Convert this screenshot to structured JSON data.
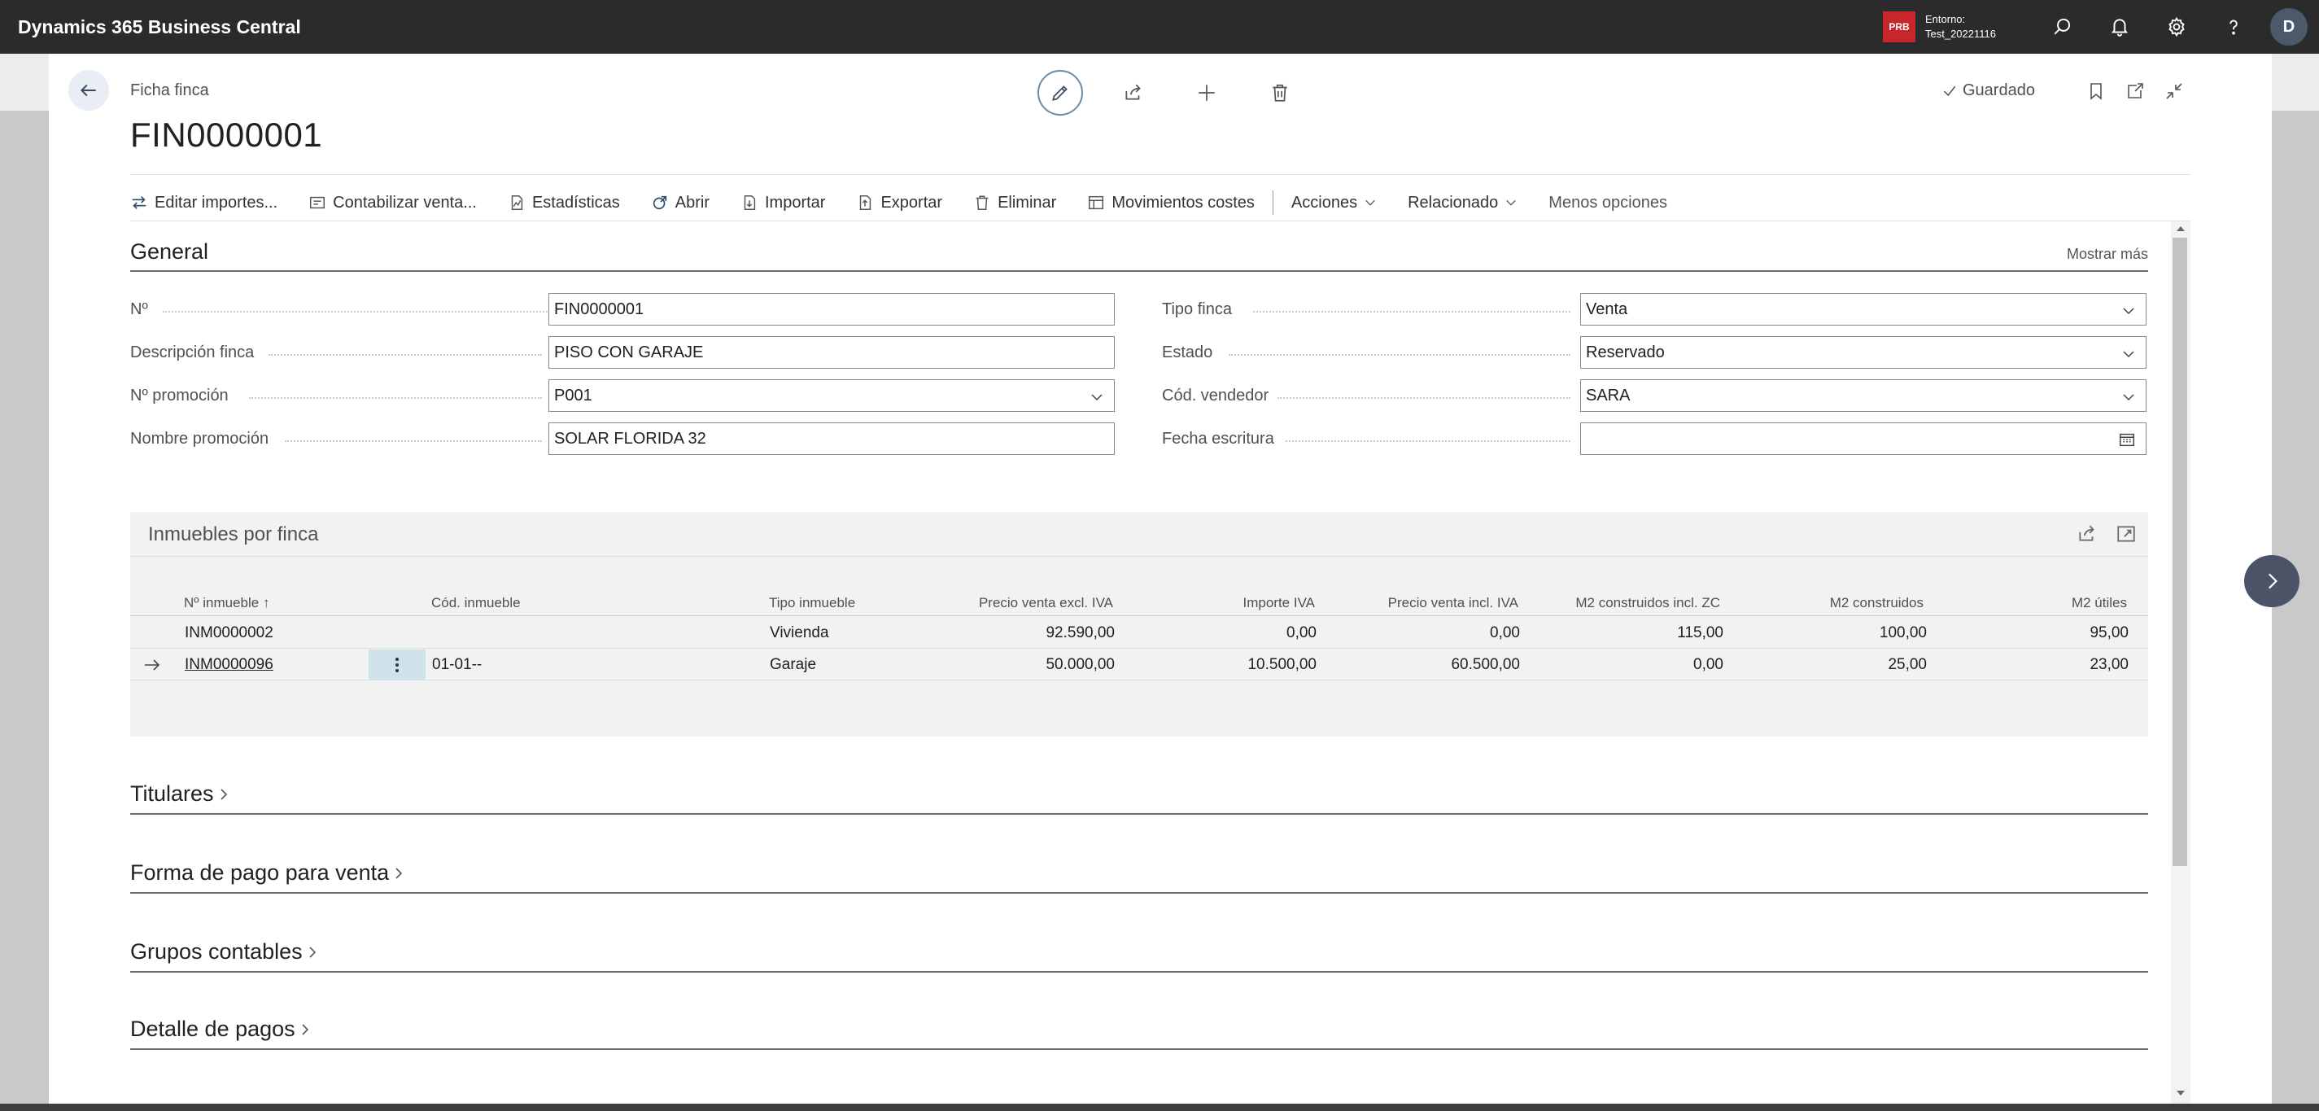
{
  "app": {
    "title": "Dynamics 365 Business Central",
    "env_badge": "PRB",
    "env_label": "Entorno:",
    "env_name": "Test_20221116",
    "user_initial": "D"
  },
  "page": {
    "caption": "Ficha finca",
    "title": "FIN0000001",
    "saved_status": "Guardado"
  },
  "actions": [
    {
      "label": "Editar importes...",
      "icon": "arrows-swap-icon"
    },
    {
      "label": "Contabilizar venta...",
      "icon": "post-icon"
    },
    {
      "label": "Estadísticas",
      "icon": "statistics-icon"
    },
    {
      "label": "Abrir",
      "icon": "open-icon"
    },
    {
      "label": "Importar",
      "icon": "import-icon"
    },
    {
      "label": "Exportar",
      "icon": "export-icon"
    },
    {
      "label": "Eliminar",
      "icon": "delete-icon"
    },
    {
      "label": "Movimientos costes",
      "icon": "entries-icon"
    }
  ],
  "action_menus": {
    "acciones": "Acciones",
    "relacionado": "Relacionado",
    "menos_opciones": "Menos opciones"
  },
  "general": {
    "title": "General",
    "show_more": "Mostrar más",
    "left_fields": [
      {
        "label": "Nº",
        "value": "FIN0000001",
        "type": "text"
      },
      {
        "label": "Descripción finca",
        "value": "PISO CON GARAJE",
        "type": "text"
      },
      {
        "label": "Nº promoción",
        "value": "P001",
        "type": "lookup"
      },
      {
        "label": "Nombre promoción",
        "value": "SOLAR FLORIDA 32",
        "type": "text"
      }
    ],
    "right_fields": [
      {
        "label": "Tipo finca",
        "value": "Venta",
        "type": "lookup"
      },
      {
        "label": "Estado",
        "value": "Reservado",
        "type": "lookup"
      },
      {
        "label": "Cód. vendedor",
        "value": "SARA",
        "type": "lookup"
      },
      {
        "label": "Fecha escritura",
        "value": "",
        "type": "date"
      }
    ]
  },
  "subpage": {
    "title": "Inmuebles por finca",
    "columns": [
      "Nº inmueble",
      "Cód. inmueble",
      "Tipo inmueble",
      "Precio venta excl. IVA",
      "Importe IVA",
      "Precio venta incl. IVA",
      "M2 construidos incl. ZC",
      "M2 construidos",
      "M2 útiles"
    ],
    "sort_indicator": "↑",
    "rows": [
      {
        "no": "INM0000002",
        "cod": "",
        "tipo": "Vivienda",
        "precio_excl": "92.590,00",
        "iva": "0,00",
        "precio_incl": "0,00",
        "m2_zc": "115,00",
        "m2_const": "100,00",
        "m2_utiles": "95,00",
        "selected": false
      },
      {
        "no": "INM0000096",
        "cod": "01-01--",
        "tipo": "Garaje",
        "precio_excl": "50.000,00",
        "iva": "10.500,00",
        "precio_incl": "60.500,00",
        "m2_zc": "0,00",
        "m2_const": "25,00",
        "m2_utiles": "23,00",
        "selected": true
      }
    ]
  },
  "sections": [
    {
      "label": "Titulares"
    },
    {
      "label": "Forma de pago para venta"
    },
    {
      "label": "Grupos contables"
    },
    {
      "label": "Detalle de pagos"
    }
  ],
  "colors": {
    "appbar": "#2b2b2b",
    "accent": "#6c8aa5",
    "badge": "#c7262c",
    "selected_cell": "#cfe2ea"
  }
}
